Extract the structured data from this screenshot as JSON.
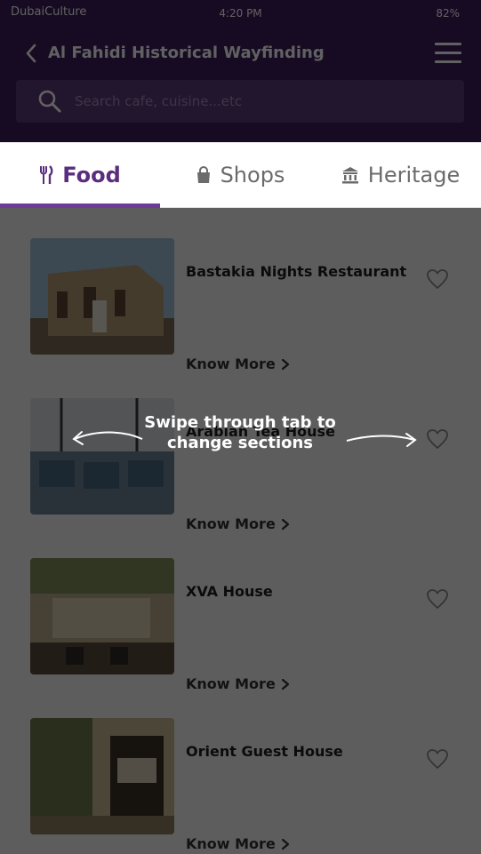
{
  "status": {
    "carrier": "DubaiCulture",
    "time": "4:20 PM",
    "battery": "82%"
  },
  "header": {
    "title": "Al Fahidi Historical Wayfinding"
  },
  "search": {
    "placeholder": "Search cafe, cuisine...etc"
  },
  "tabs": [
    {
      "label": "Food",
      "icon": "fork-knife-icon",
      "active": true
    },
    {
      "label": "Shops",
      "icon": "shopping-bag-icon",
      "active": false
    },
    {
      "label": "Heritage",
      "icon": "museum-icon",
      "active": false
    }
  ],
  "items": [
    {
      "title": "Bastakia Nights Restaurant",
      "action": "Know More"
    },
    {
      "title": "Arabian Tea House",
      "action": "Know More"
    },
    {
      "title": "XVA House",
      "action": "Know More"
    },
    {
      "title": "Orient Guest House",
      "action": "Know More"
    }
  ],
  "coach": {
    "text": "Swipe through tab to change sections"
  },
  "colors": {
    "brand": "#3d1d5e",
    "accent": "#6e3b97",
    "overlay": "rgba(0,0,0,0.62)"
  }
}
